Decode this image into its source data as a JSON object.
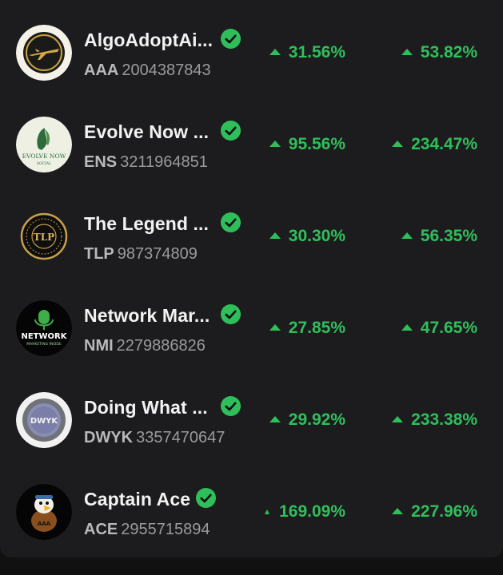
{
  "colors": {
    "background": "#111111",
    "panel": "#1c1c1e",
    "positive": "#2fbf5a",
    "verified": "#2fbf5a"
  },
  "assets": [
    {
      "name": "AlgoAdoptAi...",
      "ticker": "AAA",
      "asset_id": "2004387843",
      "change_1": "31.56%",
      "change_2": "53.82%",
      "verified": true,
      "logo": "aaa-airplane-logo"
    },
    {
      "name": "Evolve Now ...",
      "ticker": "ENS",
      "asset_id": "3211964851",
      "change_1": "95.56%",
      "change_2": "234.47%",
      "verified": true,
      "logo": "evolve-now-social-logo",
      "logo_text": "EVOLVE NOW",
      "logo_subtext": "SOCIAL"
    },
    {
      "name": "The Legend ...",
      "ticker": "TLP",
      "asset_id": "987374809",
      "change_1": "30.30%",
      "change_2": "56.35%",
      "verified": true,
      "logo": "tlp-gold-coin-logo",
      "logo_text": "TLP"
    },
    {
      "name": "Network Mar...",
      "ticker": "NMI",
      "asset_id": "2279886826",
      "change_1": "27.85%",
      "change_2": "47.65%",
      "verified": true,
      "logo": "network-marketing-inside-logo",
      "logo_text": "NETWORK",
      "logo_subtext": "MARKETING INSIDE"
    },
    {
      "name": "Doing What ...",
      "ticker": "DWYK",
      "asset_id": "3357470647",
      "change_1": "29.92%",
      "change_2": "233.38%",
      "verified": true,
      "logo": "dwyk-coin-logo",
      "logo_text": "DWYK"
    },
    {
      "name": "Captain Ace",
      "ticker": "ACE",
      "asset_id": "2955715894",
      "change_1": "169.09%",
      "change_2": "227.96%",
      "verified": true,
      "logo": "captain-ace-eagle-logo",
      "logo_text": "AAA"
    }
  ]
}
